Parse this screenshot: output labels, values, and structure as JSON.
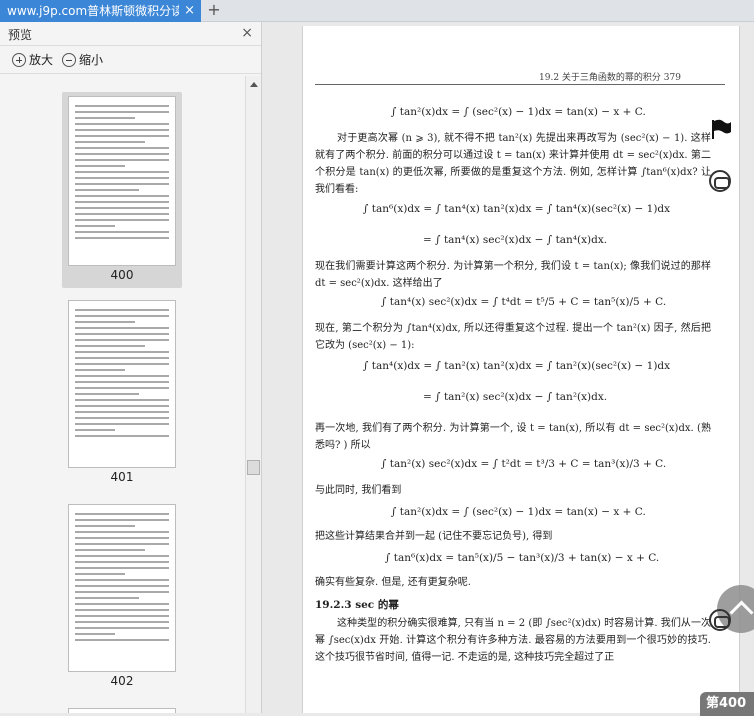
{
  "tab": {
    "title": "www.j9p.com普林斯顿微积分读",
    "close": "×",
    "add": "+"
  },
  "sidebar": {
    "title": "预览",
    "close": "×",
    "zoom_in": "放大",
    "zoom_out": "缩小",
    "thumbnails": [
      {
        "page": "400",
        "active": true
      },
      {
        "page": "401"
      },
      {
        "page": "402"
      }
    ]
  },
  "document": {
    "running_header": "19.2  关于三角函数的幂的积分    379",
    "eq1": "∫ tan²(x)dx = ∫ (sec²(x) − 1)dx = tan(x) − x + C.",
    "p1": "对于更高次幂 (n ⩾ 3), 就不得不把 tan²(x) 先提出来再改写为 (sec²(x) − 1). 这样就有了两个积分. 前面的积分可以通过设 t = tan(x) 来计算并使用 dt = sec²(x)dx. 第二个积分是 tan(x) 的更低次幂, 所要做的是重复这个方法. 例如, 怎样计算 ∫tan⁶(x)dx? 让我们看看:",
    "eq2a": "∫ tan⁶(x)dx = ∫ tan⁴(x) tan²(x)dx = ∫ tan⁴(x)(sec²(x) − 1)dx",
    "eq2b": "= ∫ tan⁴(x) sec²(x)dx − ∫ tan⁴(x)dx.",
    "p2": "现在我们需要计算这两个积分. 为计算第一个积分, 我们设 t = tan(x); 像我们说过的那样 dt = sec²(x)dx. 这样给出了",
    "eq3": "∫ tan⁴(x) sec²(x)dx = ∫ t⁴dt = t⁵/5 + C = tan⁵(x)/5 + C.",
    "p3": "现在, 第二个积分为 ∫tan⁴(x)dx, 所以还得重复这个过程. 提出一个 tan²(x) 因子, 然后把它改为 (sec²(x) − 1):",
    "eq4a": "∫ tan⁴(x)dx = ∫ tan²(x) tan²(x)dx = ∫ tan²(x)(sec²(x) − 1)dx",
    "eq4b": "= ∫ tan²(x) sec²(x)dx − ∫ tan²(x)dx.",
    "p4": "再一次地, 我们有了两个积分. 为计算第一个, 设 t = tan(x), 所以有 dt = sec²(x)dx. (熟悉吗? ) 所以",
    "eq5": "∫ tan²(x) sec²(x)dx = ∫ t²dt = t³/3 + C = tan³(x)/3 + C.",
    "p5": "与此同时, 我们看到",
    "eq6": "∫ tan²(x)dx = ∫ (sec²(x) − 1)dx = tan(x) − x + C.",
    "p6": "把这些计算结果合并到一起 (记住不要忘记负号), 得到",
    "eq7": "∫ tan⁶(x)dx = tan⁵(x)/5 − tan³(x)/3 + tan(x) − x + C.",
    "p7": "确实有些复杂. 但是, 还有更复杂呢.",
    "section": "19.2.3  sec 的幂",
    "p8": "这种类型的积分确实很难算, 只有当 n = 2 (即 ∫sec²(x)dx) 时容易计算. 我们从一次幂 ∫sec(x)dx 开始. 计算这个积分有许多种方法. 最容易的方法要用到一个很巧妙的技巧. 这个技巧很节省时间, 值得一记. 不走运的是, 这种技巧完全超过了正"
  },
  "page_badge": "第400"
}
